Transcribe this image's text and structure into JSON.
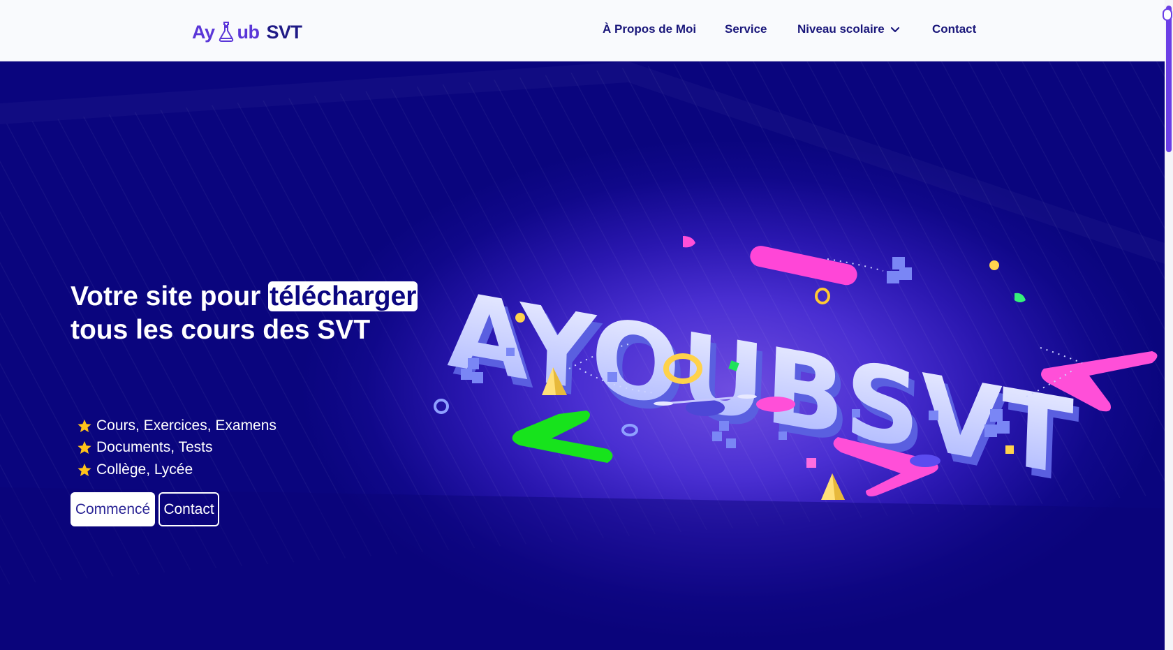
{
  "header": {
    "logo": {
      "part1": "Ay",
      "part2": "ub",
      "part3": "SVT"
    },
    "nav": [
      {
        "label": "À Propos de Moi"
      },
      {
        "label": "Service"
      },
      {
        "label": "Niveau scolaire",
        "icon": "chevron-down-icon"
      },
      {
        "label": "Contact"
      }
    ]
  },
  "hero": {
    "title_line1_before": "Votre site pour",
    "title_highlight": "télécharger",
    "title_line2_before": "tous les cours des",
    "title_line2_highlight": "SVT",
    "features": [
      {
        "icon": "star-icon",
        "text": "Cours, Exercices, Examens"
      },
      {
        "icon": "star-icon",
        "text": "Documents, Tests"
      },
      {
        "icon": "star-icon",
        "text": "Collège, Lycée"
      }
    ],
    "primary_button": "Commencé",
    "secondary_button": "Contact",
    "illustration_text": "AYOUBSVT"
  },
  "colors": {
    "header_bg": "#f9fafd",
    "nav_text": "#19167a",
    "hero_bg": "#0b0680",
    "accent_pink": "#ff4fd8",
    "accent_green": "#18e71f",
    "star": "#ffc21a",
    "scroll_thumb": "#6b3ee6"
  }
}
